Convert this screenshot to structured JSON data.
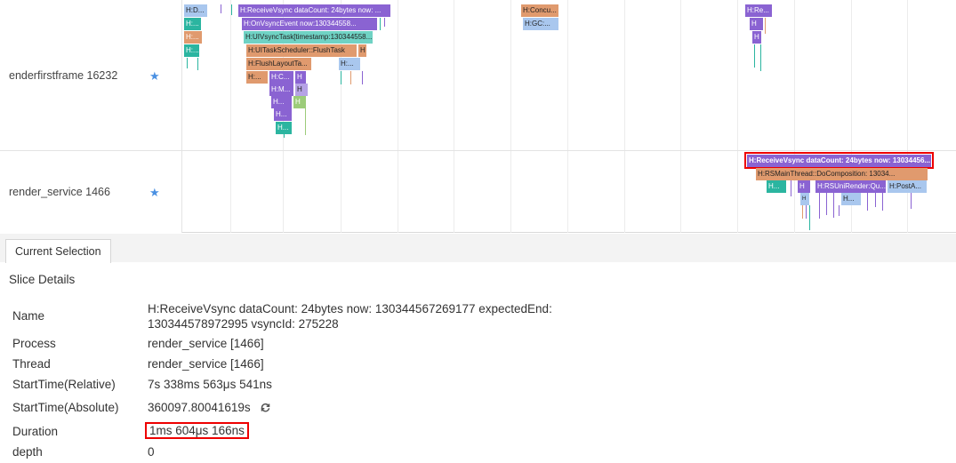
{
  "rows": [
    {
      "name": "enderfirstframe 16232",
      "icon": "star-icon"
    },
    {
      "name": "render_service 1466",
      "icon": "star-icon"
    }
  ],
  "slices_row1": {
    "hd": "H:D...",
    "h1": "H:...",
    "h2": "H:...",
    "receive": "H:ReceiveVsync dataCount: 24bytes now: ...",
    "onvsync": "H:OnVsyncEvent now:130344558...",
    "uivsync": "H:UIVsyncTask[timestamp:130344558...",
    "uitask": "H:UITaskScheduler::FlushTask",
    "flushlayout": "H:FlushLayoutTa...",
    "hsmall": "H:...",
    "hc": "H:C...",
    "hm": "H:M...",
    "hh": "H",
    "hx": "H...",
    "concu": "H:Concu...",
    "gc": "H:GC:...",
    "hre": "H:Re..."
  },
  "slices_row2": {
    "receive": "H:ReceiveVsync dataCount: 24bytes now: 13034456...",
    "rsmain": "H:RSMainThread::DoComposition: 13034...",
    "h1": "H...",
    "h2": "H",
    "rsuni": "H:RSUniRender:Qu...",
    "posta": "H:PostA...",
    "h3": "H..."
  },
  "panel": {
    "tab": "Current Selection",
    "section_title": "Slice Details",
    "details": [
      {
        "key": "Name",
        "value": "H:ReceiveVsync dataCount: 24bytes now: 130344567269177 expectedEnd: 130344578972995 vsyncId: 275228"
      },
      {
        "key": "Process",
        "value": "render_service [1466]"
      },
      {
        "key": "Thread",
        "value": "render_service [1466]"
      },
      {
        "key": "StartTime(Relative)",
        "value": "7s 338ms 563μs 541ns"
      },
      {
        "key": "StartTime(Absolute)",
        "value": "360097.80041619s"
      },
      {
        "key": "Duration",
        "value": "1ms 604μs 166ns"
      },
      {
        "key": "depth",
        "value": "0"
      }
    ]
  },
  "colors": {
    "purple": "#8a63d2",
    "teal": "#2bb5a0",
    "salmon": "#e09a6e",
    "blue": "#a9c7ee",
    "green": "#9ccc7a",
    "highlight": "#e00000",
    "star": "#4a90e2"
  }
}
